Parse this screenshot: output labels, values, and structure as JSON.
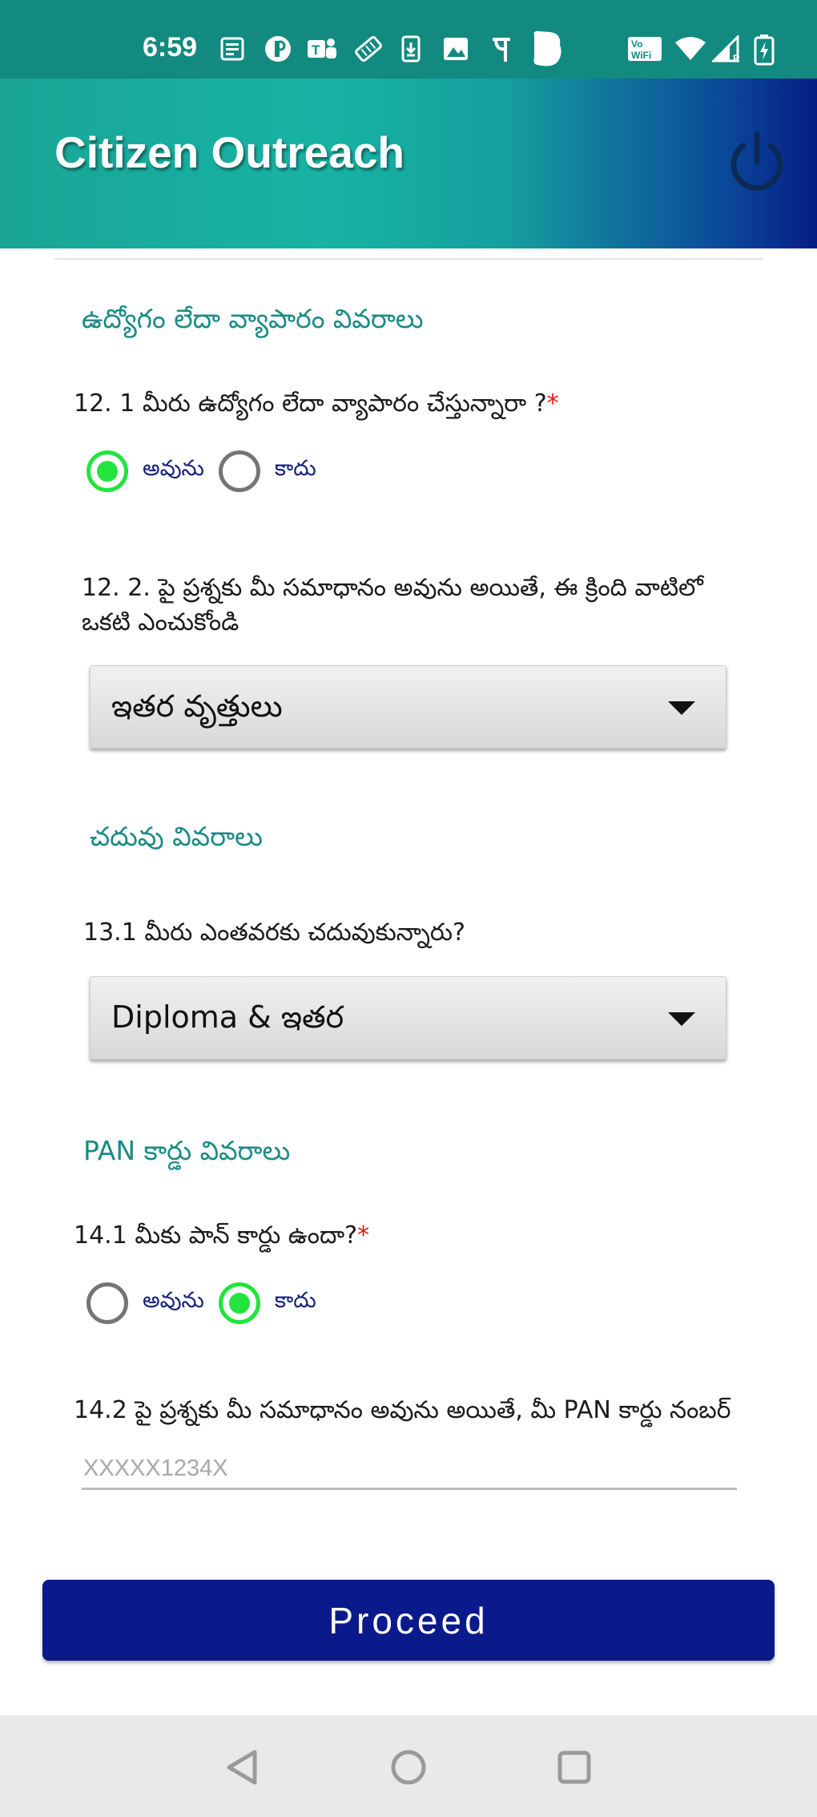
{
  "status_bar": {
    "time": "6:59",
    "icons": [
      "news-icon",
      "app-icon",
      "teams-icon",
      "tag-icon",
      "download-icon",
      "image-icon",
      "phonepe-icon",
      "b-app-icon",
      "vowifi-icon",
      "wifi-icon",
      "signal-icon",
      "battery-icon"
    ],
    "vowifi_text": "Vo WiFi"
  },
  "app_bar": {
    "title": "Citizen Outreach",
    "power_icon": "power-icon"
  },
  "sections": {
    "employment": {
      "title": "ఉద్యోగం లేదా వ్యాపారం వివరాలు",
      "q12_1": {
        "text": "12. 1 మీరు ఉద్యోగం లేదా వ్యాపారం చేస్తున్నారా ?",
        "required_mark": "*",
        "options": [
          "అవును",
          "కాదు"
        ],
        "selected": "అవును"
      },
      "q12_2": {
        "text": "12. 2. పై ప్రశ్నకు మీ సమాధానం అవును అయితే, ఈ క్రింది వాటిలో ఒకటి ఎంచుకోండి",
        "selected_value": "ఇతర వృత్తులు"
      }
    },
    "education": {
      "title": "చదువు వివరాలు",
      "q13_1": {
        "text": "13.1 మీరు ఎంతవరకు చదువుకున్నారు?",
        "selected_value": "Diploma & ఇతర"
      }
    },
    "pan": {
      "title": "PAN కార్డు వివరాలు",
      "q14_1": {
        "text": "14.1 మీకు పాన్ కార్డు ఉందా?",
        "required_mark": "*",
        "options": [
          "అవును",
          "కాదు"
        ],
        "selected": "కాదు"
      },
      "q14_2": {
        "text": "14.2 పై ప్రశ్నకు మీ సమాధానం అవును అయితే, మీ PAN కార్డు నంబర్",
        "value": "",
        "placeholder": "XXXXX1234X"
      }
    }
  },
  "proceed_label": "Proceed",
  "nav_bar": {
    "icons": [
      "back-icon",
      "home-icon",
      "recents-icon"
    ]
  },
  "colors": {
    "accent_teal": "#1a8a84",
    "radio_selected": "#22e43c",
    "proceed_button": "#0a1a8a",
    "required": "#e11111"
  }
}
